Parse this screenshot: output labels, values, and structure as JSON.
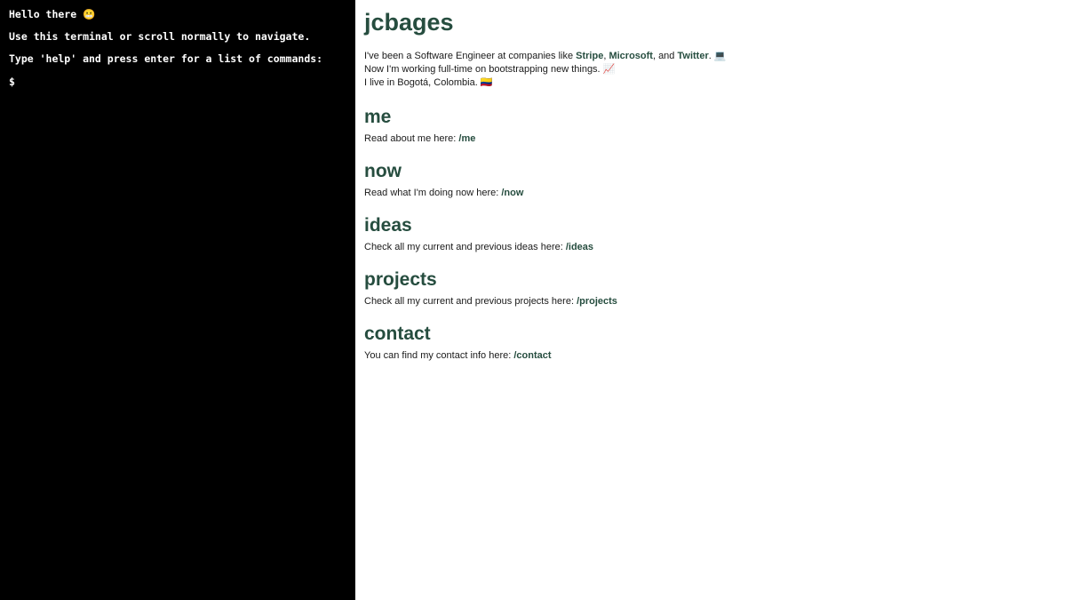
{
  "terminal": {
    "greeting": "Hello there 😬",
    "instruction_1": "Use this terminal or scroll normally to navigate.",
    "instruction_2": "Type 'help' and press enter for a list of commands:",
    "prompt": "$",
    "input_value": ""
  },
  "site": {
    "title": "jcbages"
  },
  "intro": {
    "line1_prefix": "I've been a Software Engineer at companies like ",
    "company1": "Stripe",
    "sep1": ", ",
    "company2": "Microsoft",
    "sep2": ", and ",
    "company3": "Twitter",
    "line1_suffix": ". 💻",
    "line2": "Now I'm working full-time on bootstrapping new things. 📈",
    "line3": "I live in Bogotá, Colombia. 🇨🇴"
  },
  "sections": [
    {
      "heading": "me",
      "text": "Read about me here: ",
      "link": "/me"
    },
    {
      "heading": "now",
      "text": "Read what I'm doing now here: ",
      "link": "/now"
    },
    {
      "heading": "ideas",
      "text": "Check all my current and previous ideas here: ",
      "link": "/ideas"
    },
    {
      "heading": "projects",
      "text": "Check all my current and previous projects here: ",
      "link": "/projects"
    },
    {
      "heading": "contact",
      "text": "You can find my contact info here: ",
      "link": "/contact"
    }
  ],
  "colors": {
    "accent": "#264d3f",
    "terminal_bg": "#000000",
    "terminal_fg": "#ffffff"
  }
}
